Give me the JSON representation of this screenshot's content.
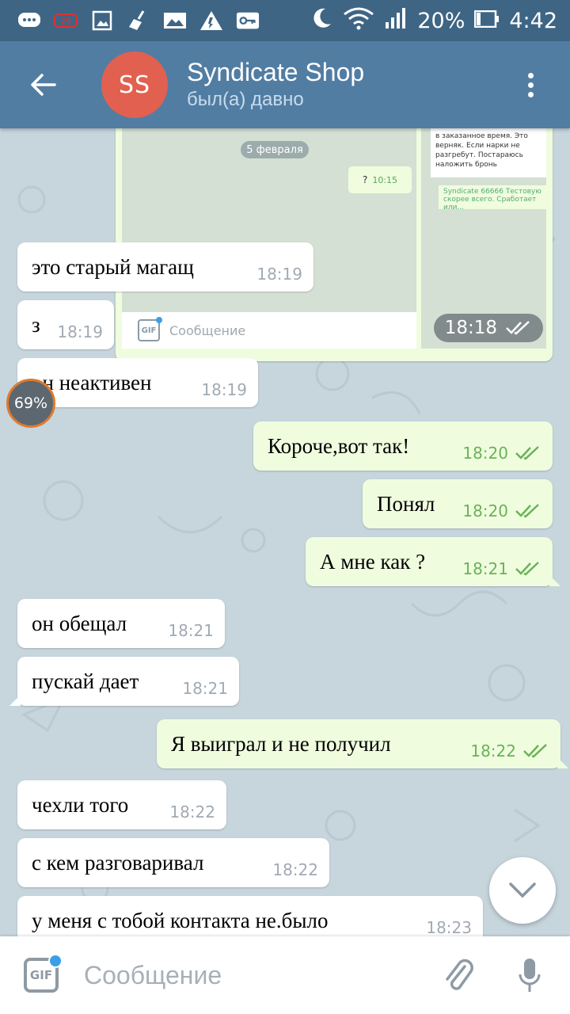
{
  "status_bar": {
    "battery_percent": "20%",
    "time": "4:42",
    "icons": [
      "chat-bubble-icon",
      "notification-badge-icon",
      "image-icon",
      "broom-icon",
      "gallery-icon",
      "warning-icon",
      "key-icon",
      "moon-icon",
      "wifi-icon",
      "signal-icon",
      "battery-icon"
    ]
  },
  "header": {
    "avatar_initials": "SS",
    "title": "Syndicate Shop",
    "subtitle": "был(а) давно",
    "avatar_color": "#e2604f",
    "bar_color": "#527da3"
  },
  "image_message": {
    "time": "18:18",
    "thumb_date": "5 февраля",
    "thumb_mini_text": "?",
    "thumb_mini_time": "10:15",
    "thumb_placeholder": "Сообщение",
    "thumb_right_text": "в заказанное время. Это верняк. Если нарки не разгребут. Постараюсь наложить бронь",
    "thumb_right_reply": "Syndicate 66666 Тестовую скорее всего. Сработает или..."
  },
  "messages": [
    {
      "dir": "in",
      "text": "это старый магащ",
      "time": "18:19"
    },
    {
      "dir": "in",
      "text": "з",
      "time": "18:19"
    },
    {
      "dir": "in",
      "text": "он неактивен",
      "time": "18:19"
    },
    {
      "dir": "out",
      "text": "Короче,вот так!",
      "time": "18:20"
    },
    {
      "dir": "out",
      "text": "Понял",
      "time": "18:20"
    },
    {
      "dir": "out",
      "text": "А мне как ?",
      "time": "18:21"
    },
    {
      "dir": "in",
      "text": "он обещал",
      "time": "18:21"
    },
    {
      "dir": "in",
      "text": "пускай дает",
      "time": "18:21"
    },
    {
      "dir": "out",
      "text": "Я выиграл  и не получил",
      "time": "18:22"
    },
    {
      "dir": "in",
      "text": "чехли того",
      "time": "18:22"
    },
    {
      "dir": "in",
      "text": "с кем разговаривал",
      "time": "18:22"
    },
    {
      "dir": "in",
      "text": "у меня с тобой контакта не.было",
      "time": "18:23"
    }
  ],
  "progress_badge": "69%",
  "progress_value": 69,
  "input": {
    "gif_label": "GIF",
    "placeholder": "Сообщение",
    "value": ""
  },
  "colors": {
    "incoming_bubble": "#ffffff",
    "outgoing_bubble": "#effdde",
    "outgoing_time": "#6bb257",
    "chat_background": "#c7d5dd"
  }
}
